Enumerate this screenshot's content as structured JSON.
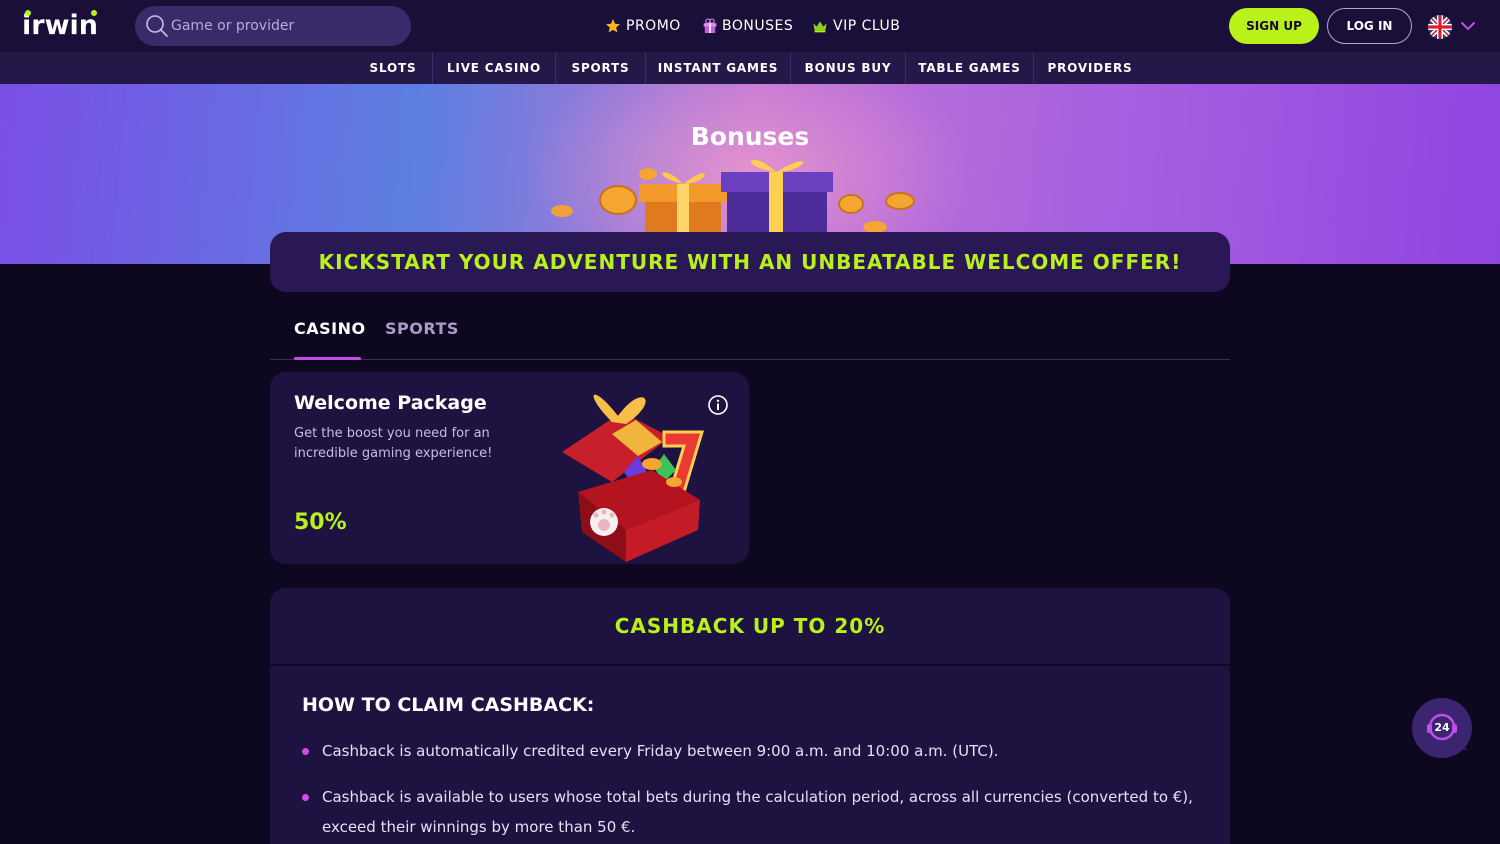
{
  "header": {
    "logo": "irwin",
    "search_placeholder": "Game or provider",
    "nav": [
      {
        "label": "PROMO",
        "icon": "star-icon"
      },
      {
        "label": "BONUSES",
        "icon": "gift-icon"
      },
      {
        "label": "VIP CLUB",
        "icon": "crown-icon"
      }
    ],
    "signup_label": "SIGN UP",
    "login_label": "LOG IN",
    "language_icon": "uk-flag-icon"
  },
  "categories": [
    "SLOTS",
    "LIVE CASINO",
    "SPORTS",
    "INSTANT GAMES",
    "BONUS BUY",
    "TABLE GAMES",
    "PROVIDERS"
  ],
  "hero": {
    "title": "Bonuses"
  },
  "offer_banner": "KICKSTART YOUR ADVENTURE WITH AN UNBEATABLE WELCOME OFFER!",
  "tabs": [
    {
      "label": "CASINO",
      "active": true
    },
    {
      "label": "SPORTS",
      "active": false
    }
  ],
  "welcome_card": {
    "title": "Welcome Package",
    "description": "Get the boost you need for an incredible gaming experience!",
    "percent": "50%"
  },
  "cashback": {
    "title": "CASHBACK UP TO 20%",
    "subtitle": "HOW TO CLAIM CASHBACK:",
    "items": [
      "Cashback is automatically credited every Friday between 9:00 a.m. and 10:00 a.m. (UTC).",
      "Cashback is available to users whose total bets during the calculation period, across all currencies (converted to €), exceed their winnings by more than 50 €."
    ]
  },
  "support_badge": "24",
  "colors": {
    "accent_green": "#b9f21a",
    "accent_purple": "#c04ee8",
    "bg": "#0d0720",
    "panel": "#1e1340"
  }
}
